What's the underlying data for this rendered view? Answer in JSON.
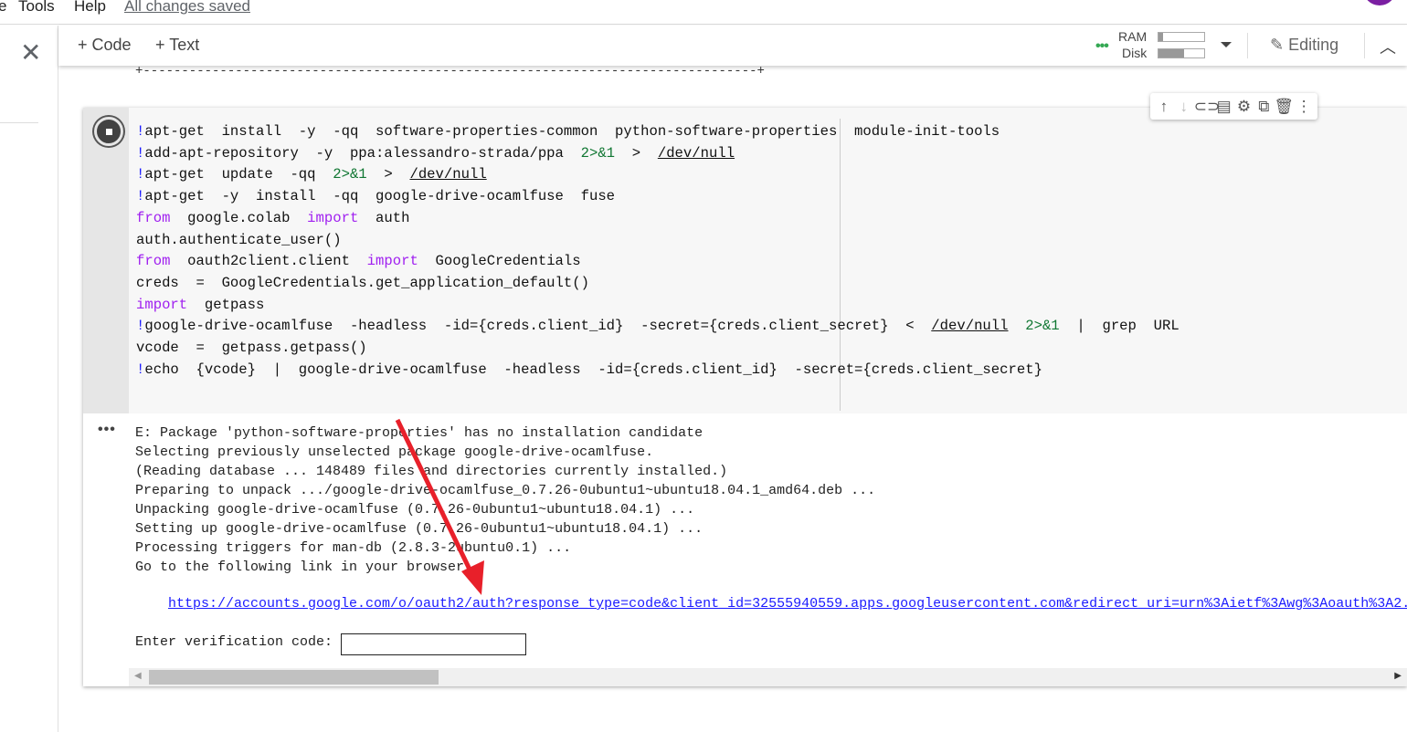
{
  "menu": {
    "items": [
      "e",
      "Tools",
      "Help"
    ],
    "save_status": "All changes saved"
  },
  "toolbar": {
    "add_code": "+ Code",
    "add_text": "+ Text",
    "ram_label": "RAM",
    "disk_label": "Disk",
    "ram_usage": 0.1,
    "disk_usage": 0.55,
    "editing_label": "Editing"
  },
  "previous_output": "+--------------------------------------------------------------------------------+",
  "cell_toolbar": {
    "icons": [
      "arrow-up-icon",
      "arrow-down-icon",
      "link-icon",
      "comment-icon",
      "settings-icon",
      "mirror-cell-icon",
      "delete-icon",
      "more-vert-icon"
    ]
  },
  "code_lines": [
    [
      [
        "b",
        "!"
      ],
      [
        "",
        "apt-get  install  -y  -qq  software-properties-common  python-software-properties  module-init-tools"
      ]
    ],
    [
      [
        "b",
        "!"
      ],
      [
        "",
        "add-apt-repository  -y  ppa:alessandro-strada/ppa  "
      ],
      [
        "n",
        "2>&1"
      ],
      [
        "",
        "  >  "
      ],
      [
        "u",
        "/dev/null"
      ]
    ],
    [
      [
        "b",
        "!"
      ],
      [
        "",
        "apt-get  update  -qq  "
      ],
      [
        "n",
        "2>&1"
      ],
      [
        "",
        "  >  "
      ],
      [
        "u",
        "/dev/null"
      ]
    ],
    [
      [
        "b",
        "!"
      ],
      [
        "",
        "apt-get  -y  install  -qq  google-drive-ocamlfuse  fuse"
      ]
    ],
    [
      [
        "k",
        "from"
      ],
      [
        "",
        "  google.colab  "
      ],
      [
        "k",
        "import"
      ],
      [
        "",
        "  auth"
      ]
    ],
    [
      [
        "",
        "auth.authenticate_user()"
      ]
    ],
    [
      [
        "k",
        "from"
      ],
      [
        "",
        "  oauth2client.client  "
      ],
      [
        "k",
        "import"
      ],
      [
        "",
        "  GoogleCredentials"
      ]
    ],
    [
      [
        "",
        "creds  =  GoogleCredentials.get_application_default()"
      ]
    ],
    [
      [
        "k",
        "import"
      ],
      [
        "",
        "  getpass"
      ]
    ],
    [
      [
        "b",
        "!"
      ],
      [
        "",
        "google-drive-ocamlfuse  -headless  -id={creds.client_id}  -secret={creds.client_secret}  <  "
      ],
      [
        "u",
        "/dev/null"
      ],
      [
        "",
        "  "
      ],
      [
        "n",
        "2>&1"
      ],
      [
        "",
        "  |  grep  URL"
      ]
    ],
    [
      [
        "",
        "vcode  =  getpass.getpass()"
      ]
    ],
    [
      [
        "b",
        "!"
      ],
      [
        "",
        "echo  {vcode}  |  google-drive-ocamlfuse  -headless  -id={creds.client_id}  -secret={creds.client_secret}"
      ]
    ]
  ],
  "output": {
    "lines": [
      "E: Package 'python-software-properties' has no installation candidate",
      "Selecting previously unselected package google-drive-ocamlfuse.",
      "(Reading database ... 148489 files and directories currently installed.)",
      "Preparing to unpack .../google-drive-ocamlfuse_0.7.26-0ubuntu1~ubuntu18.04.1_amd64.deb ...",
      "Unpacking google-drive-ocamlfuse (0.7.26-0ubuntu1~ubuntu18.04.1) ...",
      "Setting up google-drive-ocamlfuse (0.7.26-0ubuntu1~ubuntu18.04.1) ...",
      "Processing triggers for man-db (2.8.3-2ubuntu0.1) ...",
      "Go to the following link in your browser:"
    ],
    "link": "https://accounts.google.com/o/oauth2/auth?response_type=code&client_id=32555940559.apps.googleusercontent.com&redirect_uri=urn%3Aietf%3Awg%3Aoauth%3A2.",
    "verification_label": "Enter verification code:",
    "verification_value": ""
  },
  "annotation": {
    "arrow_color": "#e8202a"
  }
}
